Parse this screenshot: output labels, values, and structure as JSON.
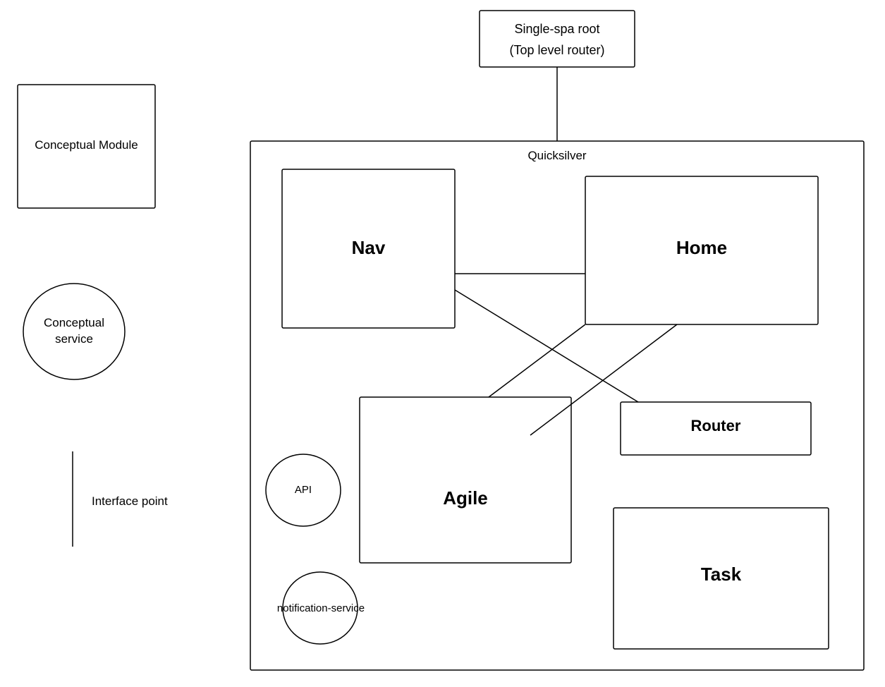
{
  "root": {
    "line1": "Single-spa root",
    "line2": "(Top level router)"
  },
  "legend": {
    "module": "Conceptual Module",
    "service_line1": "Conceptual",
    "service_line2": "service",
    "interface": "Interface point"
  },
  "container": {
    "title": "Quicksilver",
    "modules": {
      "nav": "Nav",
      "home": "Home",
      "agile": "Agile",
      "task": "Task",
      "router": "Router"
    },
    "services": {
      "api": "API",
      "notification": "notification-service"
    }
  }
}
